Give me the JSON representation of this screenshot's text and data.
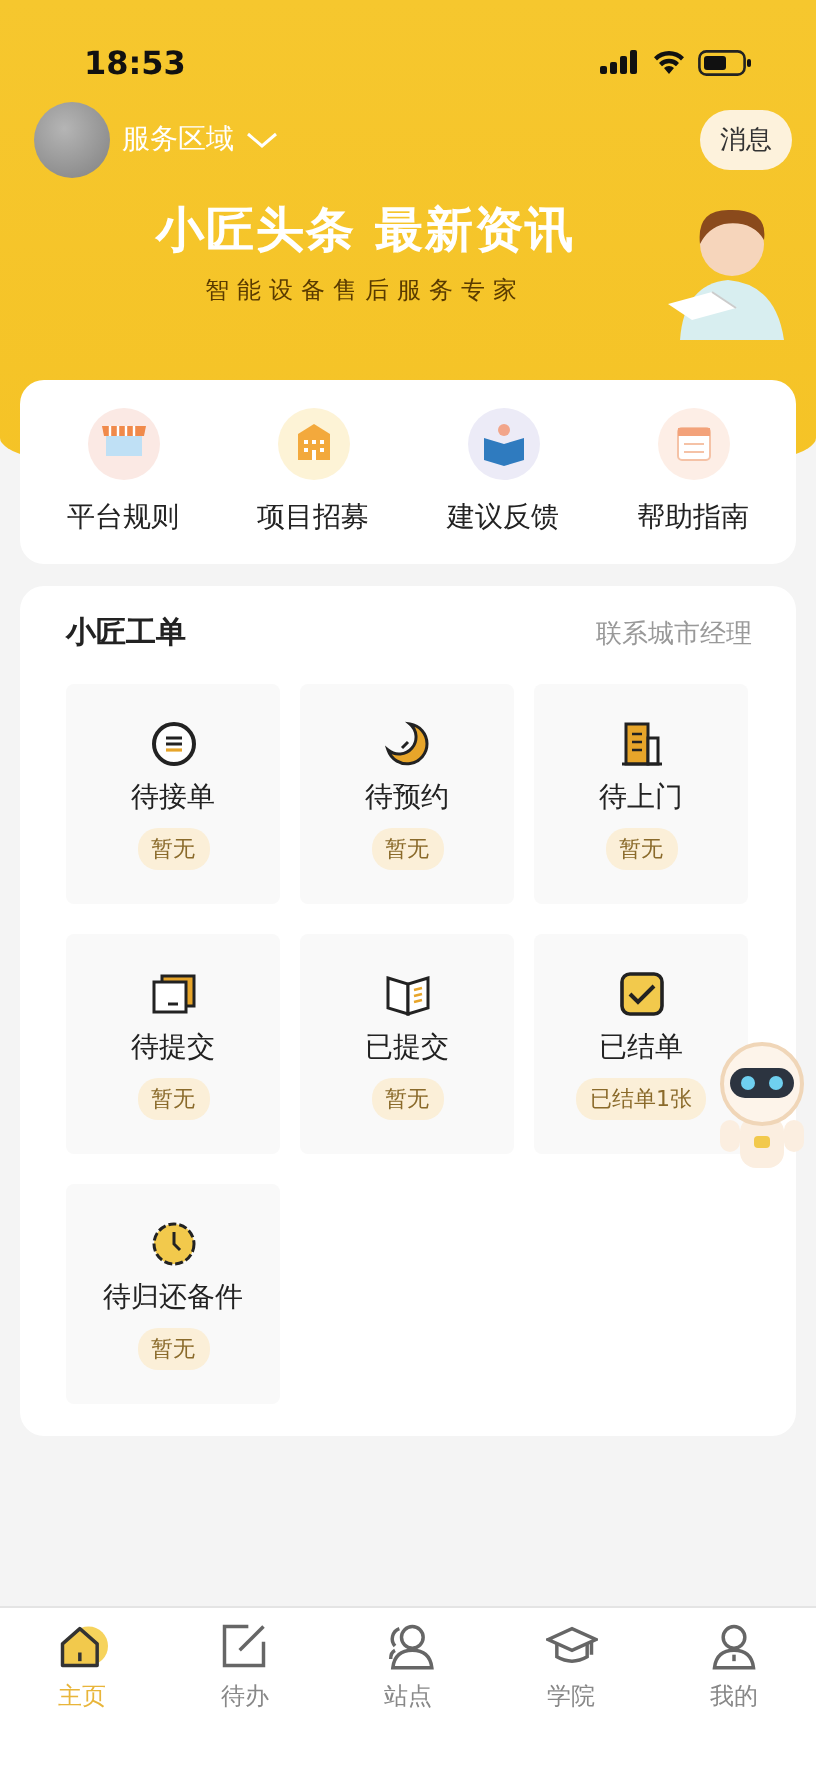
{
  "status_bar": {
    "time": "18:53"
  },
  "header": {
    "region": "服务区域",
    "message_button": "消息"
  },
  "banner": {
    "headline": "小匠头条 最新资讯",
    "subtitle": "智能设备售后服务专家"
  },
  "shortcuts": [
    {
      "kind": "store",
      "label": "平台规则"
    },
    {
      "kind": "building",
      "label": "项目招募"
    },
    {
      "kind": "book",
      "label": "建议反馈"
    },
    {
      "kind": "calendar",
      "label": "帮助指南"
    }
  ],
  "orders": {
    "title": "小匠工单",
    "link": "联系城市经理",
    "items": [
      {
        "kind": "list",
        "label": "待接单",
        "badge": "暂无"
      },
      {
        "kind": "moon",
        "label": "待预约",
        "badge": "暂无"
      },
      {
        "kind": "building",
        "label": "待上门",
        "badge": "暂无"
      },
      {
        "kind": "card",
        "label": "待提交",
        "badge": "暂无"
      },
      {
        "kind": "book",
        "label": "已提交",
        "badge": "暂无"
      },
      {
        "kind": "check",
        "label": "已结单",
        "badge": "已结单1张"
      },
      {
        "kind": "clock",
        "label": "待归还备件",
        "badge": "暂无"
      }
    ]
  },
  "tab_bar": [
    {
      "kind": "home",
      "label": "主页",
      "selected": true
    },
    {
      "kind": "edit",
      "label": "待办",
      "selected": false
    },
    {
      "kind": "people",
      "label": "站点",
      "selected": false
    },
    {
      "kind": "cap",
      "label": "学院",
      "selected": false
    },
    {
      "kind": "person",
      "label": "我的",
      "selected": false
    }
  ]
}
